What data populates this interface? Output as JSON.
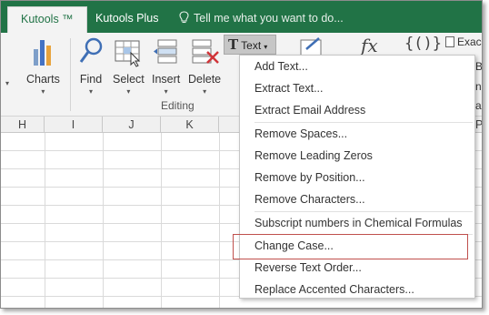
{
  "tabs": {
    "kutools": "Kutools ™",
    "kutools_plus": "Kutools Plus",
    "tell_me": "Tell me what you want to do..."
  },
  "ribbon": {
    "charts": "Charts",
    "find": "Find",
    "select": "Select",
    "insert": "Insert",
    "delete": "Delete",
    "text": "Text",
    "exact": "Exac",
    "group_editing": "Editing",
    "partial_b": "B",
    "partial_n": "n",
    "partial_a": "a"
  },
  "columns": [
    "H",
    "I",
    "J",
    "K",
    "",
    "",
    "",
    "",
    "P"
  ],
  "menu": {
    "items": [
      "Add Text...",
      "Extract Text...",
      "Extract Email Address",
      "Remove Spaces...",
      "Remove Leading Zeros",
      "Remove by Position...",
      "Remove Characters...",
      "Subscript numbers in Chemical Formulas",
      "Change Case...",
      "Reverse Text Order...",
      "Replace Accented Characters..."
    ]
  },
  "colors": {
    "ribbon_green": "#217346",
    "highlight_red": "#c0504d"
  }
}
